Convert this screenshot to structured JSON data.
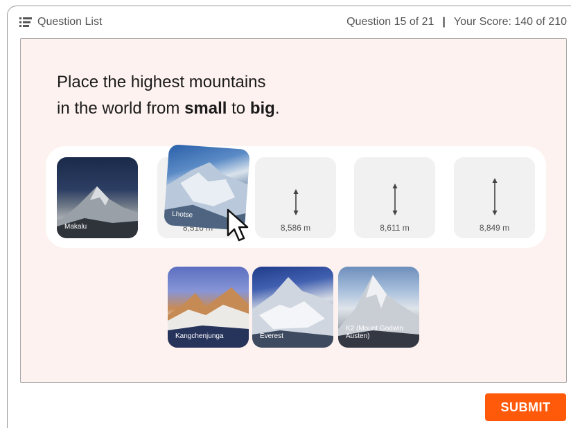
{
  "topbar": {
    "question_list_label": "Question List",
    "question_counter": "Question 15 of 21",
    "separator": "|",
    "score": "Your Score: 140 of 210"
  },
  "question": {
    "line1": "Place the highest mountains",
    "line2_pre": "in the world from ",
    "word_small": "small",
    "word_to": " to ",
    "word_big": "big",
    "line2_end": "."
  },
  "slots": [
    {
      "height": ""
    },
    {
      "height": "8,516 m"
    },
    {
      "height": "8,586 m"
    },
    {
      "height": "8,611 m"
    },
    {
      "height": "8,849 m"
    }
  ],
  "placed_cards": [
    {
      "name": "Makalu"
    }
  ],
  "dragging_card": {
    "name": "Lhotse"
  },
  "pool_cards": [
    {
      "name": "Kangchenjunga"
    },
    {
      "name": "Everest"
    },
    {
      "name": "K2 (Mount Godwin Austen)"
    }
  ],
  "submit_label": "SUBMIT",
  "colors": {
    "accent": "#ff5a0a",
    "panel_bg": "#fdf2ef",
    "slot_bg": "#f1f1f1"
  }
}
